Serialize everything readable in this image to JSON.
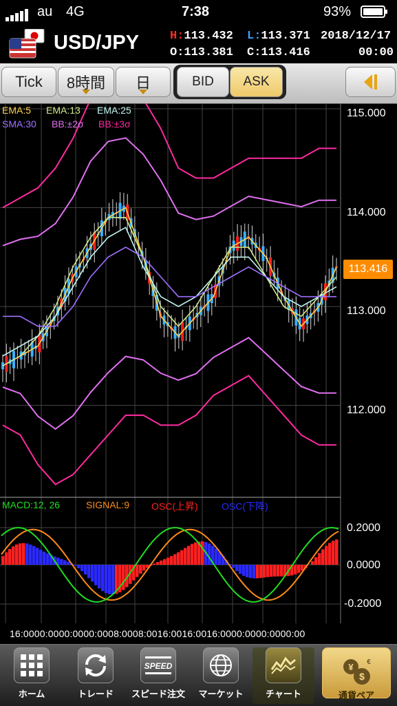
{
  "status_bar": {
    "carrier": "au",
    "network": "4G",
    "time": "7:38",
    "battery": "93%"
  },
  "header": {
    "pair": "USD/JPY",
    "flag_icon": "us-jp-flag-icon",
    "high_label": "H:",
    "high": "113.432",
    "low_label": "L:",
    "low": "113.371",
    "open_label": "O:",
    "open": "113.381",
    "close_label": "C:",
    "close": "113.416",
    "date": "2018/12/17",
    "time": "00:00"
  },
  "toolbar": {
    "tick": "Tick",
    "timeframe": "8時間",
    "period": "日",
    "bid": "BID",
    "ask": "ASK",
    "selected_side": "ASK",
    "collapse_icon": "chevron-left-icon"
  },
  "price_chart": {
    "legend": [
      {
        "text": "EMA:5",
        "color": "#ffd24a"
      },
      {
        "text": "EMA:13",
        "color": "#cfe88a"
      },
      {
        "text": "EMA:25",
        "color": "#bff5f0"
      },
      {
        "text": "SMA:30",
        "color": "#a070ff"
      },
      {
        "text": "BB:±2σ",
        "color": "#e070f0"
      },
      {
        "text": "BB:±3σ",
        "color": "#ff2aa0"
      }
    ],
    "ticks": [
      "115.000",
      "114.000",
      "113.000",
      "112.000"
    ],
    "current_price": "113.416",
    "current_price_color": "#ff8c00"
  },
  "macd_chart": {
    "legend": [
      {
        "text": "MACD:12, 26",
        "color": "#22dd22"
      },
      {
        "text": "SIGNAL:9",
        "color": "#ff8c1a"
      },
      {
        "text": "OSC(上昇)",
        "color": "#ff2020"
      },
      {
        "text": "OSC(下降)",
        "color": "#2a2aff"
      }
    ],
    "ticks": [
      "0.2000",
      "0.0000",
      "-0.2000"
    ]
  },
  "x_axis_labels": "16:0000:0000:0000:0008:0008:0016:0016:0016:0000:0000:0000:00",
  "tabs": [
    {
      "label": "ホーム",
      "icon": "grid-icon"
    },
    {
      "label": "トレード",
      "icon": "refresh-arrows-icon"
    },
    {
      "label": "スピード注文",
      "icon": "speed-icon"
    },
    {
      "label": "マーケット",
      "icon": "globe-icon"
    },
    {
      "label": "チャート",
      "icon": "chart-icon",
      "active": true
    },
    {
      "label": "通貨ペア",
      "icon": "currency-gear-icon"
    }
  ],
  "chart_data": {
    "type": "line",
    "ylim": [
      111.1,
      115.2
    ],
    "series": [
      {
        "name": "EMA:5",
        "values": [
          112.4,
          112.5,
          112.6,
          112.9,
          113.3,
          113.6,
          113.9,
          114.0,
          113.5,
          112.9,
          112.7,
          112.9,
          113.1,
          113.6,
          113.7,
          113.5,
          113.1,
          112.8,
          113.0,
          113.4
        ]
      },
      {
        "name": "EMA:13",
        "values": [
          112.4,
          112.5,
          112.7,
          113.0,
          113.4,
          113.7,
          113.9,
          113.9,
          113.5,
          113.0,
          112.8,
          113.0,
          113.3,
          113.6,
          113.6,
          113.3,
          113.0,
          112.9,
          113.1,
          113.3
        ]
      },
      {
        "name": "EMA:25",
        "values": [
          112.5,
          112.6,
          112.7,
          112.9,
          113.2,
          113.5,
          113.7,
          113.8,
          113.4,
          113.1,
          113.0,
          113.1,
          113.3,
          113.5,
          113.5,
          113.3,
          113.1,
          113.0,
          113.1,
          113.2
        ]
      },
      {
        "name": "SMA:30",
        "values": [
          112.9,
          112.9,
          112.8,
          112.8,
          113.0,
          113.3,
          113.5,
          113.6,
          113.5,
          113.3,
          113.1,
          113.1,
          113.2,
          113.3,
          113.4,
          113.3,
          113.2,
          113.1,
          113.1,
          113.1
        ]
      }
    ]
  }
}
